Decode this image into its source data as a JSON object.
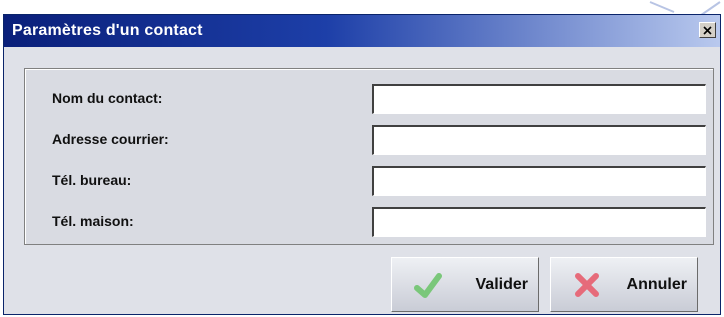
{
  "window": {
    "title": "Paramètres d'un contact"
  },
  "fields": [
    {
      "label": "Nom du contact:",
      "value": ""
    },
    {
      "label": "Adresse courrier:",
      "value": ""
    },
    {
      "label": "Tél. bureau:",
      "value": ""
    },
    {
      "label": "Tél. maison:",
      "value": ""
    }
  ],
  "buttons": {
    "validate_label": "Valider",
    "cancel_label": "Annuler"
  },
  "colors": {
    "titlebar": "#0a1f7a",
    "validate_icon": "#7ac77a",
    "cancel_icon": "#e66b7a"
  },
  "icons": {
    "close": "close-icon",
    "validate": "checkmark-icon",
    "cancel": "x-cross-icon"
  }
}
